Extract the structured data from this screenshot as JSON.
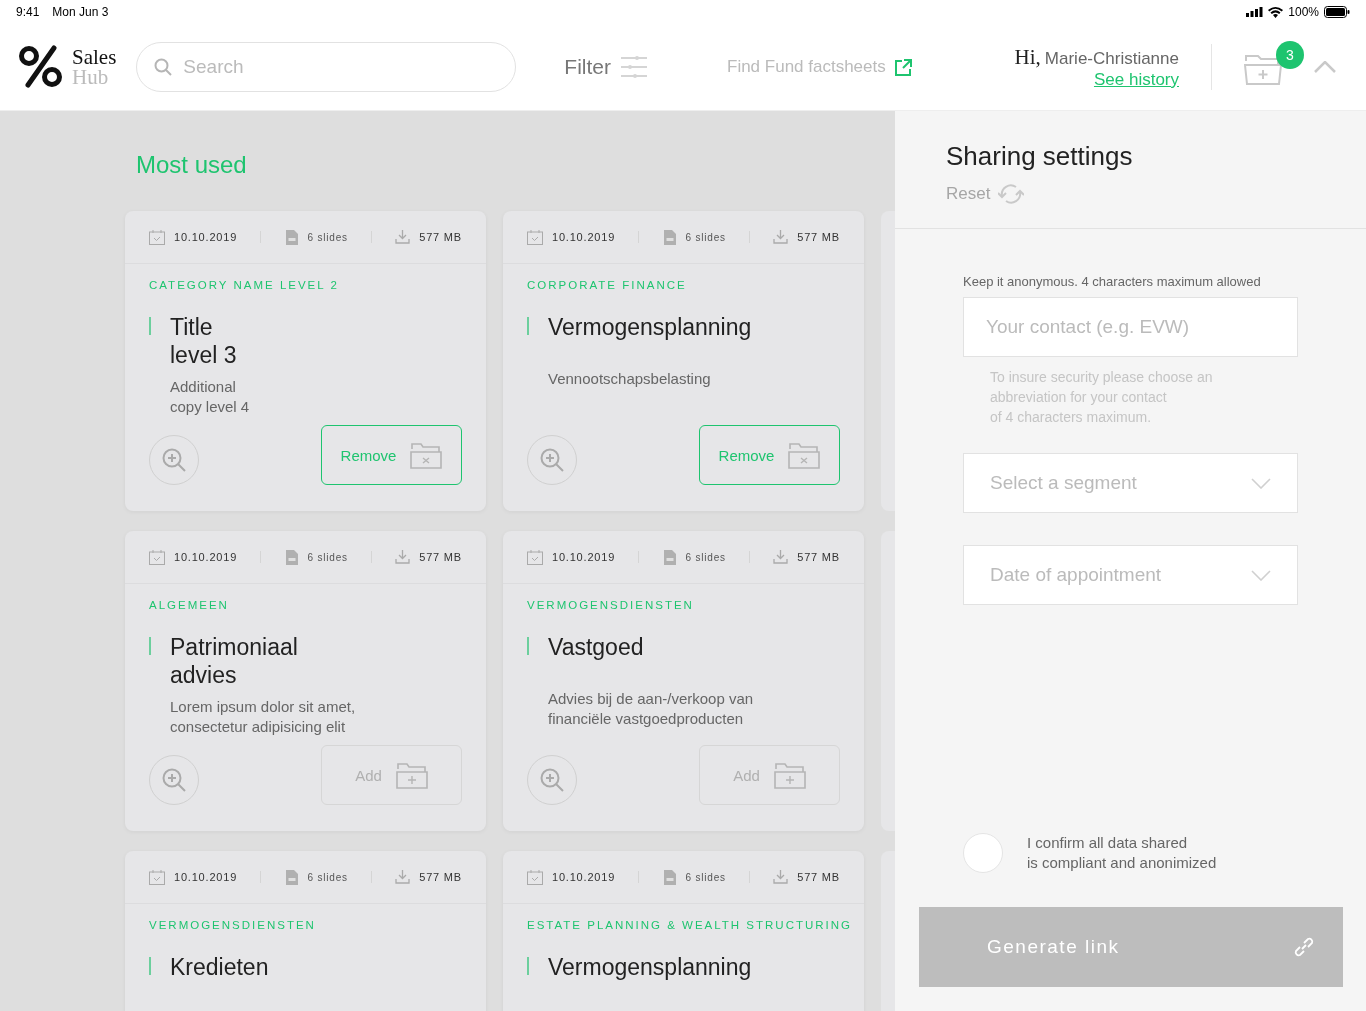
{
  "status_bar": {
    "time": "9:41",
    "date": "Mon Jun 3",
    "battery": "100%"
  },
  "header": {
    "logo_top": "Sales",
    "logo_bottom": "Hub",
    "search": {
      "placeholder": "Search"
    },
    "filter": "Filter",
    "factsheets_link": "Find Fund factsheets",
    "greeting": "Hi,",
    "user_name": "Marie-Christianne",
    "history_link": "See history",
    "cart_count": "3"
  },
  "section_title": "Most used",
  "cards": [
    {
      "date": "10.10.2019",
      "slides": "6 slides",
      "size": "577 MB",
      "category": "CATEGORY NAME LEVEL 2",
      "title": "Title\nlevel 3",
      "description": "Additional\ncopy level 4",
      "action": {
        "label": "Remove",
        "selected": true
      }
    },
    {
      "date": "10.10.2019",
      "slides": "6 slides",
      "size": "577 MB",
      "category": "CORPORATE FINANCE",
      "title": "Vermogensplanning",
      "description": "\nVennootschapsbelasting",
      "action": {
        "label": "Remove",
        "selected": true
      }
    },
    {
      "date": "10.10.2019",
      "slides": "6 slides",
      "size": "577 MB",
      "category": "ALGEMEEN",
      "title": "Patrimoniaal\nadvies",
      "description": "Lorem ipsum dolor sit amet,\nconsectetur adipisicing elit",
      "action": {
        "label": "Add",
        "selected": false
      }
    },
    {
      "date": "10.10.2019",
      "slides": "6 slides",
      "size": "577 MB",
      "category": "VERMOGENSDIENSTEN",
      "title": "Vastgoed",
      "description": "\nAdvies bij de aan-/verkoop van\nfinanciële vastgoedproducten",
      "action": {
        "label": "Add",
        "selected": false
      }
    },
    {
      "date": "10.10.2019",
      "slides": "6 slides",
      "size": "577 MB",
      "category": "VERMOGENSDIENSTEN",
      "title": "Kredieten"
    },
    {
      "date": "10.10.2019",
      "slides": "6 slides",
      "size": "577 MB",
      "category": "ESTATE PLANNING & WEALTH STRUCTURING",
      "title": "Vermogensplanning"
    }
  ],
  "panel": {
    "title": "Sharing settings",
    "reset": "Reset",
    "contact_label": "Keep it anonymous. 4 characters maximum allowed",
    "contact": {
      "placeholder": "Your contact (e.g. EVW)"
    },
    "contact_hint": "To insure security please choose an\nabbreviation for your contact\nof 4 characters maximum.",
    "selects": [
      {
        "placeholder": "Select a segment"
      },
      {
        "placeholder": "Date of appointment"
      }
    ],
    "confirm": {
      "label": "I confirm all data shared\nis compliant and anonimized",
      "checked": false
    },
    "generate": {
      "label": "Generate link",
      "disabled": true
    }
  }
}
